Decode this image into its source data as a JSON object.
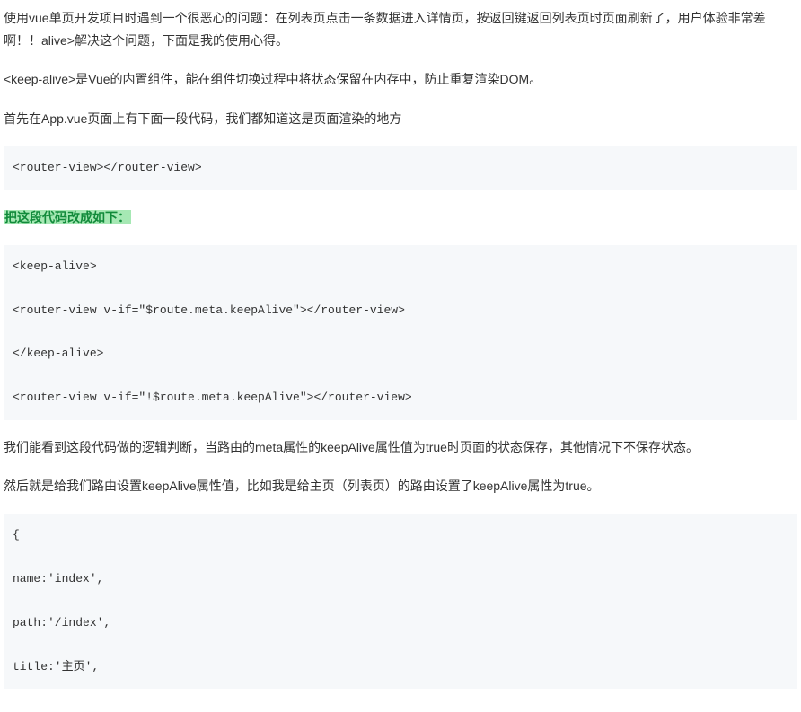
{
  "para1": "使用vue单页开发项目时遇到一个很恶心的问题：在列表页点击一条数据进入详情页，按返回键返回列表页时页面刷新了，用户体验非常差啊！！alive>解决这个问题，下面是我的使用心得。",
  "para2": "<keep-alive>是Vue的内置组件，能在组件切换过程中将状态保留在内存中，防止重复渲染DOM。",
  "para3": "首先在App.vue页面上有下面一段代码，我们都知道这是页面渲染的地方",
  "code1": "<router-view></router-view>",
  "highlight1": "把这段代码改成如下：",
  "code2_line1": "<keep-alive>",
  "code2_line2": "<router-view v-if=\"$route.meta.keepAlive\"></router-view>",
  "code2_line3": "</keep-alive>",
  "code2_line4": "<router-view v-if=\"!$route.meta.keepAlive\"></router-view>",
  "para4": "我们能看到这段代码做的逻辑判断，当路由的meta属性的keepAlive属性值为true时页面的状态保存，其他情况下不保存状态。",
  "para5": "然后就是给我们路由设置keepAlive属性值，比如我是给主页（列表页）的路由设置了keepAlive属性为true。",
  "code3_line1": "{",
  "code3_line2": "name:'index',",
  "code3_line3": "path:'/index',",
  "code3_line4": "title:'主页',"
}
